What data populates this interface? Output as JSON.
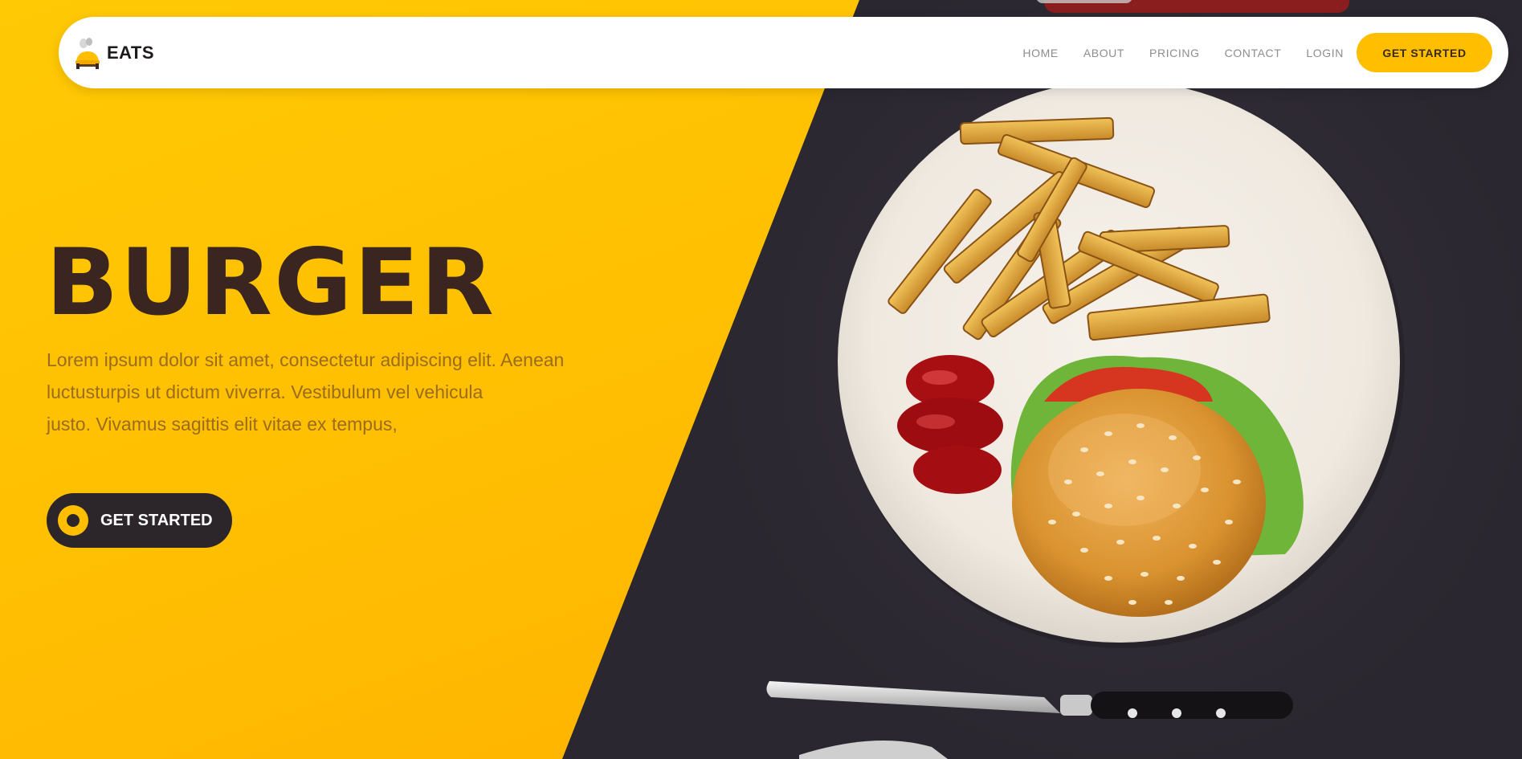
{
  "brand": {
    "name": "EATS",
    "logo_icon": "chef-hat-food-icon"
  },
  "nav": {
    "links": [
      {
        "label": "HOME"
      },
      {
        "label": "ABOUT"
      },
      {
        "label": "PRICING"
      },
      {
        "label": "CONTACT"
      },
      {
        "label": "LOGIN"
      }
    ],
    "cta_label": "GET STARTED"
  },
  "hero": {
    "title": "BURGER",
    "text_lines": [
      "Lorem ipsum dolor sit amet, consectetur adipiscing elit. Aenean",
      "luctusturpis ut dictum viverra. Vestibulum vel vehicula",
      "justo. Vivamus sagittis elit vitae ex tempus,"
    ],
    "cta_label": "GET STARTED",
    "image_subject": "burger-fries-plate-image"
  },
  "colors": {
    "accent_yellow": "#ffbf00",
    "dark_brown": "#3a2520",
    "dark_background": "#2b2730",
    "muted_text": "#9b6c1e"
  }
}
